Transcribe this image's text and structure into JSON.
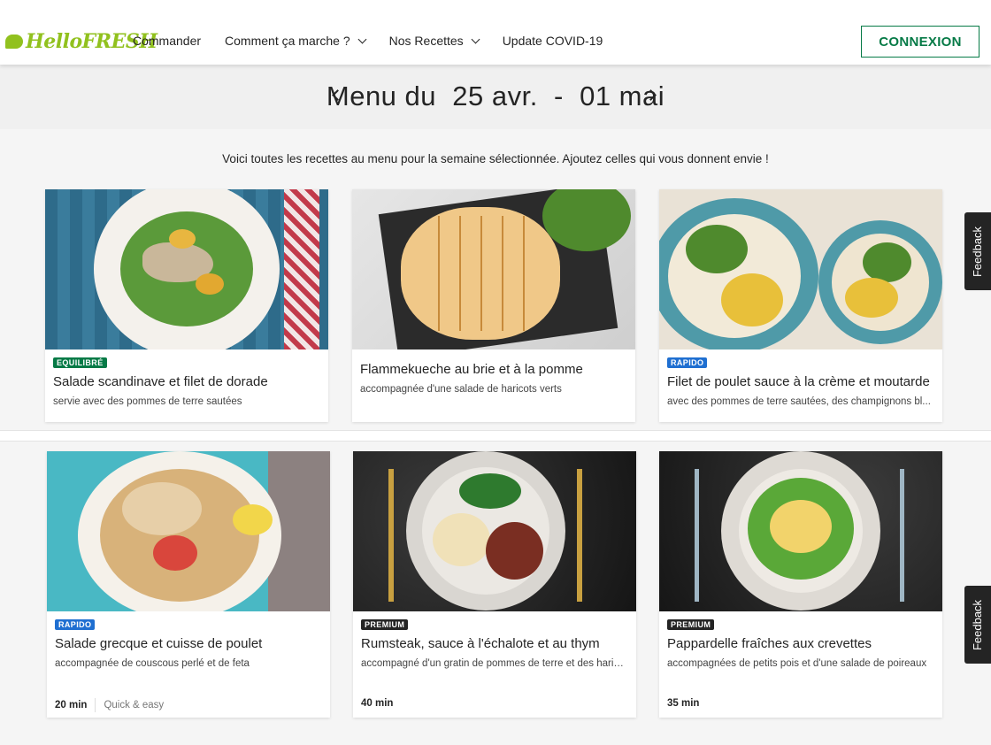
{
  "header": {
    "logo": "HelloFRESH",
    "nav": [
      {
        "label": "Commander",
        "dropdown": false
      },
      {
        "label": "Comment ça marche ?",
        "dropdown": true
      },
      {
        "label": "Nos Recettes",
        "dropdown": true
      },
      {
        "label": "Update COVID-19",
        "dropdown": false
      }
    ],
    "login_label": "CONNEXION"
  },
  "week": {
    "title": "Menu du  25 avr.  -  01 mai"
  },
  "intro": "Voici toutes les recettes au menu pour la semaine sélectionnée. Ajoutez celles qui vous donnent envie !",
  "recipes": [
    {
      "badge": "EQUILIBRÉ",
      "badge_color": "#067a46",
      "title": "Salade scandinave et filet de dorade",
      "subtitle": "servie avec des pommes de terre sautées",
      "image": "fish-salad-image"
    },
    {
      "badge": "",
      "badge_color": "",
      "title": "Flammekueche au brie et à la pomme",
      "subtitle": "accompagnée d'une salade de haricots verts",
      "image": "flammekueche-image"
    },
    {
      "badge": "RAPIDO",
      "badge_color": "#1f6fd1",
      "title": "Filet de poulet sauce à la crème et moutarde",
      "subtitle": "avec des pommes de terre sautées, des champignons bl...",
      "image": "chicken-cream-image"
    },
    {
      "badge": "RAPIDO",
      "badge_color": "#1f6fd1",
      "title": "Salade grecque et cuisse de poulet",
      "subtitle": "accompagnée de couscous perlé et de feta",
      "time": "20 min",
      "tag": "Quick & easy",
      "image": "greek-salad-image"
    },
    {
      "badge": "PREMIUM",
      "badge_color": "#242424",
      "title": "Rumsteak, sauce à l'échalote et au thym",
      "subtitle": "accompagné d'un gratin de pommes de terre et des haricots verts",
      "time": "40 min",
      "tag": "",
      "image": "steak-image"
    },
    {
      "badge": "PREMIUM",
      "badge_color": "#242424",
      "title": "Pappardelle fraîches aux crevettes",
      "subtitle": "accompagnées de petits pois et d'une salade de poireaux",
      "time": "35 min",
      "tag": "",
      "image": "pasta-shrimp-image"
    }
  ],
  "feedback_label": "Feedback",
  "colors": {
    "brand_green": "#91c11e",
    "login_green": "#067a46",
    "rapido_blue": "#1f6fd1"
  }
}
